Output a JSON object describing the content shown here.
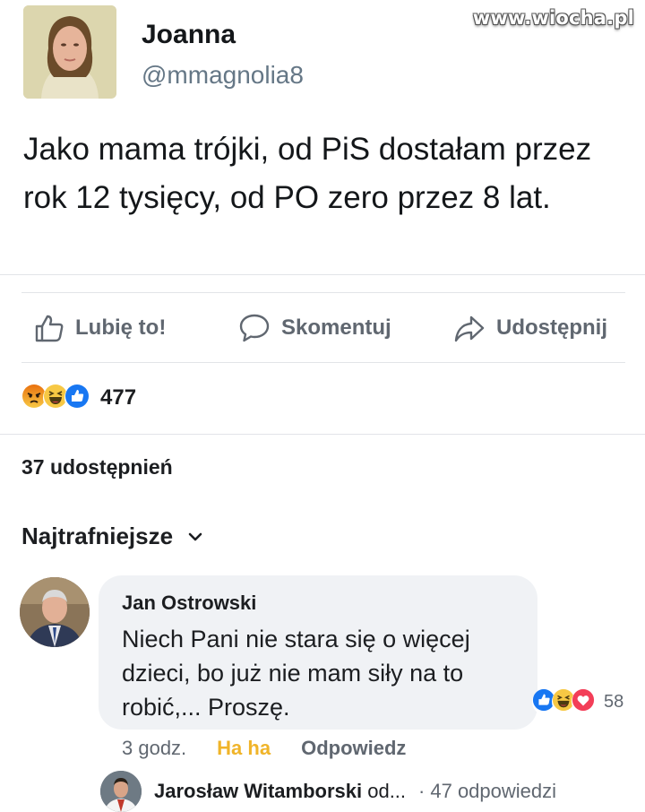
{
  "watermark": "www.wiocha.pl",
  "tweet": {
    "name": "Joanna",
    "handle": "@mmagnolia8",
    "text": "Jako mama trójki, od PiS dostałam przez rok 12 tysięcy, od PO zero przez 8 lat."
  },
  "actions": {
    "like": "Lubię to!",
    "comment": "Skomentuj",
    "share": "Udostępnij"
  },
  "reactions": {
    "icons": [
      "angry-icon",
      "haha-icon",
      "like-icon"
    ],
    "count": "477"
  },
  "shares": "37 udostępnień",
  "sort_label": "Najtrafniejsze",
  "comment": {
    "author": "Jan Ostrowski",
    "text": "Niech Pani nie stara się o więcej dzieci, bo już nie mam siły na to robić,... Proszę.",
    "reactions": [
      "like-icon",
      "haha-icon",
      "love-icon"
    ],
    "reaction_count": "58",
    "time": "3 godz.",
    "reaction_label": "Ha ha",
    "reply_label": "Odpowiedz"
  },
  "reply_preview": {
    "author": "Jarosław Witamborski",
    "suffix": " od...",
    "count": "47 odpowiedzi"
  },
  "colors": {
    "like_blue": "#1877f2",
    "haha_yellow": "#f7c844",
    "angry_orange": "#e9710f",
    "love_red": "#f33e58",
    "muted": "#606770"
  }
}
